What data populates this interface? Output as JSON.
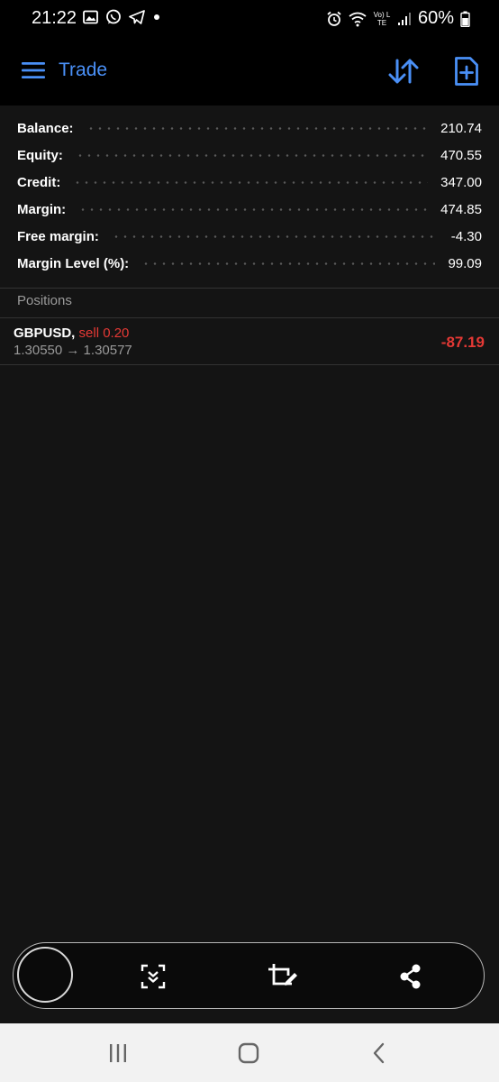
{
  "status_bar": {
    "time": "21:22",
    "battery_pct": "60%",
    "network_label": "Vo) LTE",
    "left_icons": [
      "image-icon",
      "whatsapp-icon",
      "telegram-icon",
      "dot-icon"
    ],
    "right_icons": [
      "alarm-icon",
      "wifi-icon",
      "lte-icon",
      "signal-icon",
      "battery-icon"
    ]
  },
  "app_bar": {
    "title": "Trade",
    "accent_color": "#4a90f7",
    "icons": [
      "menu-icon",
      "sort-icon",
      "new-order-icon"
    ]
  },
  "account_summary": [
    {
      "label": "Balance:",
      "value": "210.74"
    },
    {
      "label": "Equity:",
      "value": "470.55"
    },
    {
      "label": "Credit:",
      "value": "347.00"
    },
    {
      "label": "Margin:",
      "value": "474.85"
    },
    {
      "label": "Free margin:",
      "value": "-4.30"
    },
    {
      "label": "Margin Level (%):",
      "value": "99.09"
    }
  ],
  "positions": {
    "header": "Positions",
    "items": [
      {
        "symbol": "GBPUSD,",
        "side": "sell 0.20",
        "prices": "1.30550 → 1.30577",
        "profit": "-87.19",
        "loss_color": "#e53935"
      }
    ]
  },
  "capture_toolbar": {
    "icons": [
      "capture-circle",
      "scroll-capture-icon",
      "crop-edit-icon",
      "share-icon"
    ]
  },
  "nav_bar": {
    "icons": [
      "recent-apps-icon",
      "home-icon",
      "back-icon"
    ]
  }
}
